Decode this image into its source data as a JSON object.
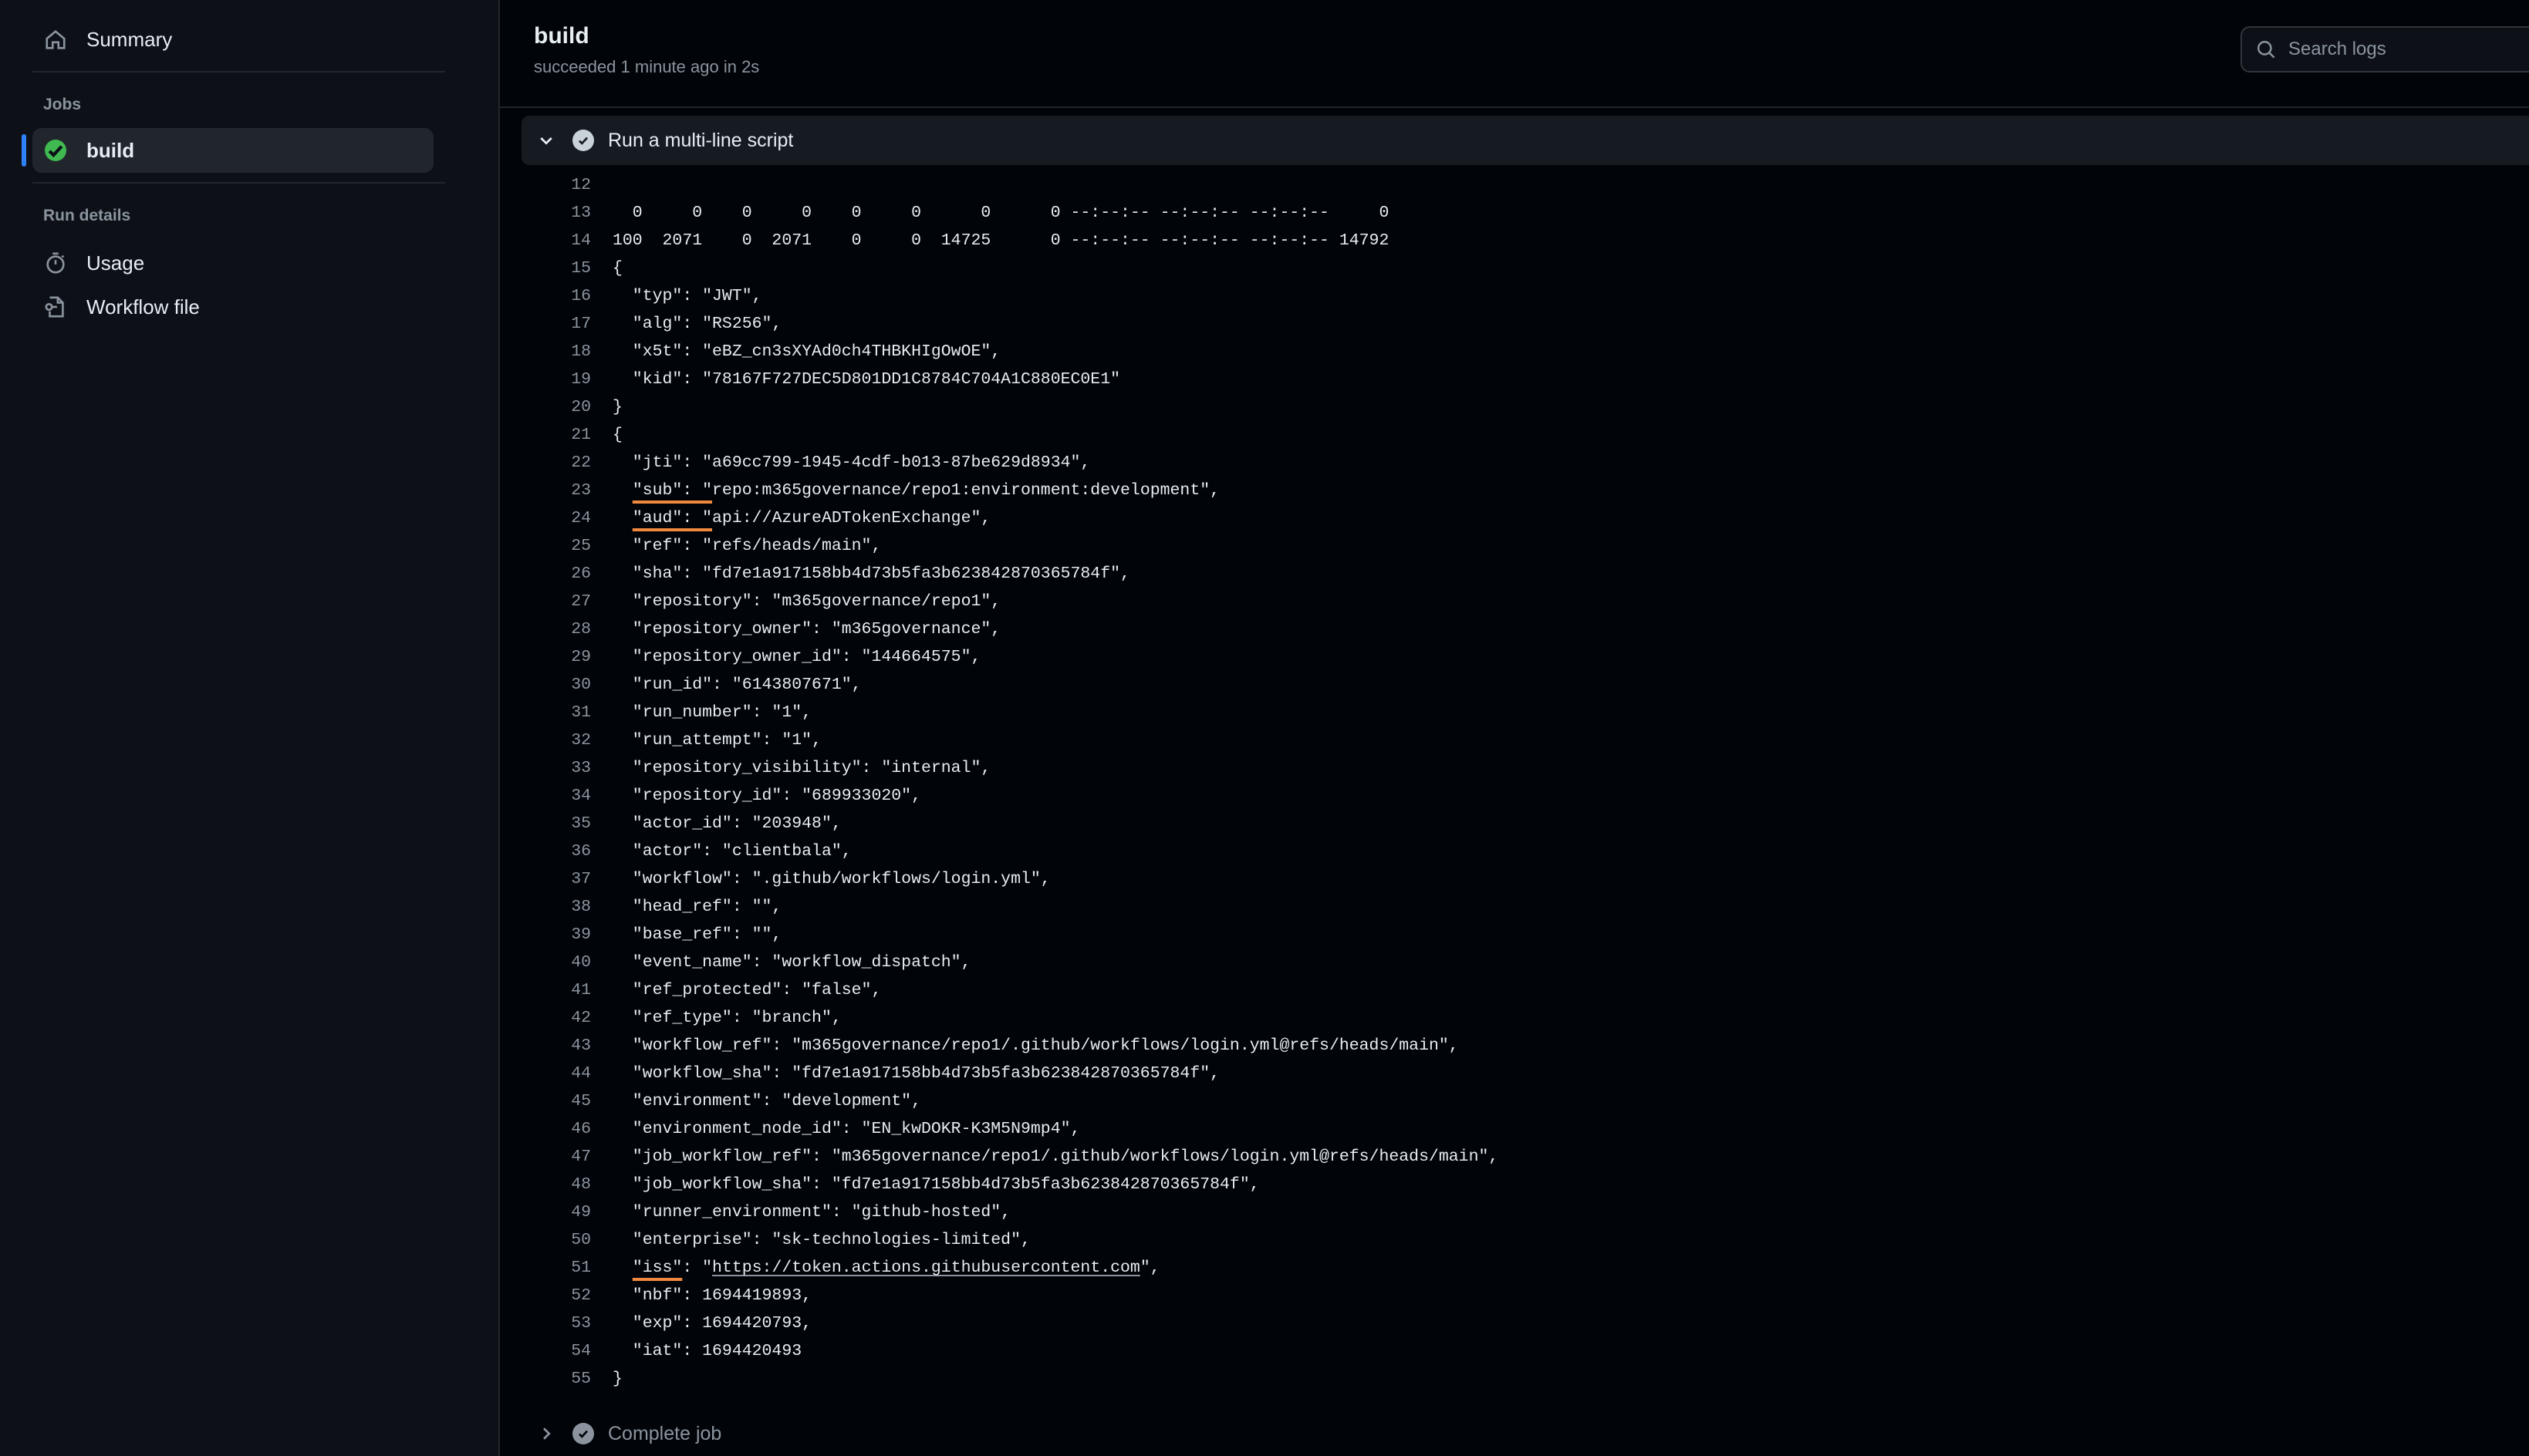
{
  "sidebar": {
    "summary": "Summary",
    "jobs_title": "Jobs",
    "job": "build",
    "run_details_title": "Run details",
    "usage": "Usage",
    "workflow_file": "Workflow file"
  },
  "header": {
    "title": "build",
    "subtitle": "succeeded 1 minute ago in 2s",
    "search_placeholder": "Search logs"
  },
  "step": {
    "title": "Run a multi-line script",
    "complete_title": "Complete job"
  },
  "log_lines": [
    {
      "n": "12",
      "t": ""
    },
    {
      "n": "13",
      "t": "  0     0    0     0    0     0      0      0 --:--:-- --:--:-- --:--:--     0"
    },
    {
      "n": "14",
      "t": "100  2071    0  2071    0     0  14725      0 --:--:-- --:--:-- --:--:-- 14792"
    },
    {
      "n": "15",
      "t": "{"
    },
    {
      "n": "16",
      "t": "  \"typ\": \"JWT\","
    },
    {
      "n": "17",
      "t": "  \"alg\": \"RS256\","
    },
    {
      "n": "18",
      "t": "  \"x5t\": \"eBZ_cn3sXYAd0ch4THBKHIgOwOE\","
    },
    {
      "n": "19",
      "t": "  \"kid\": \"78167F727DEC5D801DD1C8784C704A1C880EC0E1\""
    },
    {
      "n": "20",
      "t": "}"
    },
    {
      "n": "21",
      "t": "{"
    },
    {
      "n": "22",
      "t": "  \"jti\": \"a69cc799-1945-4cdf-b013-87be629d8934\","
    },
    {
      "n": "23",
      "pre": "  ",
      "hl": "\"sub\": \"",
      "t": "repo:m365governance/repo1:environment:development\","
    },
    {
      "n": "24",
      "pre": "  ",
      "hl": "\"aud\": \"",
      "t": "api://AzureADTokenExchange\","
    },
    {
      "n": "25",
      "t": "  \"ref\": \"refs/heads/main\","
    },
    {
      "n": "26",
      "t": "  \"sha\": \"fd7e1a917158bb4d73b5fa3b623842870365784f\","
    },
    {
      "n": "27",
      "t": "  \"repository\": \"m365governance/repo1\","
    },
    {
      "n": "28",
      "t": "  \"repository_owner\": \"m365governance\","
    },
    {
      "n": "29",
      "t": "  \"repository_owner_id\": \"144664575\","
    },
    {
      "n": "30",
      "t": "  \"run_id\": \"6143807671\","
    },
    {
      "n": "31",
      "t": "  \"run_number\": \"1\","
    },
    {
      "n": "32",
      "t": "  \"run_attempt\": \"1\","
    },
    {
      "n": "33",
      "t": "  \"repository_visibility\": \"internal\","
    },
    {
      "n": "34",
      "t": "  \"repository_id\": \"689933020\","
    },
    {
      "n": "35",
      "t": "  \"actor_id\": \"203948\","
    },
    {
      "n": "36",
      "t": "  \"actor\": \"clientbala\","
    },
    {
      "n": "37",
      "t": "  \"workflow\": \".github/workflows/login.yml\","
    },
    {
      "n": "38",
      "t": "  \"head_ref\": \"\","
    },
    {
      "n": "39",
      "t": "  \"base_ref\": \"\","
    },
    {
      "n": "40",
      "t": "  \"event_name\": \"workflow_dispatch\","
    },
    {
      "n": "41",
      "t": "  \"ref_protected\": \"false\","
    },
    {
      "n": "42",
      "t": "  \"ref_type\": \"branch\","
    },
    {
      "n": "43",
      "t": "  \"workflow_ref\": \"m365governance/repo1/.github/workflows/login.yml@refs/heads/main\","
    },
    {
      "n": "44",
      "t": "  \"workflow_sha\": \"fd7e1a917158bb4d73b5fa3b623842870365784f\","
    },
    {
      "n": "45",
      "t": "  \"environment\": \"development\","
    },
    {
      "n": "46",
      "t": "  \"environment_node_id\": \"EN_kwDOKR-K3M5N9mp4\","
    },
    {
      "n": "47",
      "t": "  \"job_workflow_ref\": \"m365governance/repo1/.github/workflows/login.yml@refs/heads/main\","
    },
    {
      "n": "48",
      "t": "  \"job_workflow_sha\": \"fd7e1a917158bb4d73b5fa3b623842870365784f\","
    },
    {
      "n": "49",
      "t": "  \"runner_environment\": \"github-hosted\","
    },
    {
      "n": "50",
      "t": "  \"enterprise\": \"sk-technologies-limited\","
    },
    {
      "n": "51",
      "pre": "  ",
      "hl": "\"iss\"",
      "t": ": \"",
      "link": "https://token.actions.githubusercontent.com",
      "post": "\","
    },
    {
      "n": "52",
      "t": "  \"nbf\": 1694419893,"
    },
    {
      "n": "53",
      "t": "  \"exp\": 1694420793,"
    },
    {
      "n": "54",
      "t": "  \"iat\": 1694420493"
    },
    {
      "n": "55",
      "t": "}"
    }
  ]
}
